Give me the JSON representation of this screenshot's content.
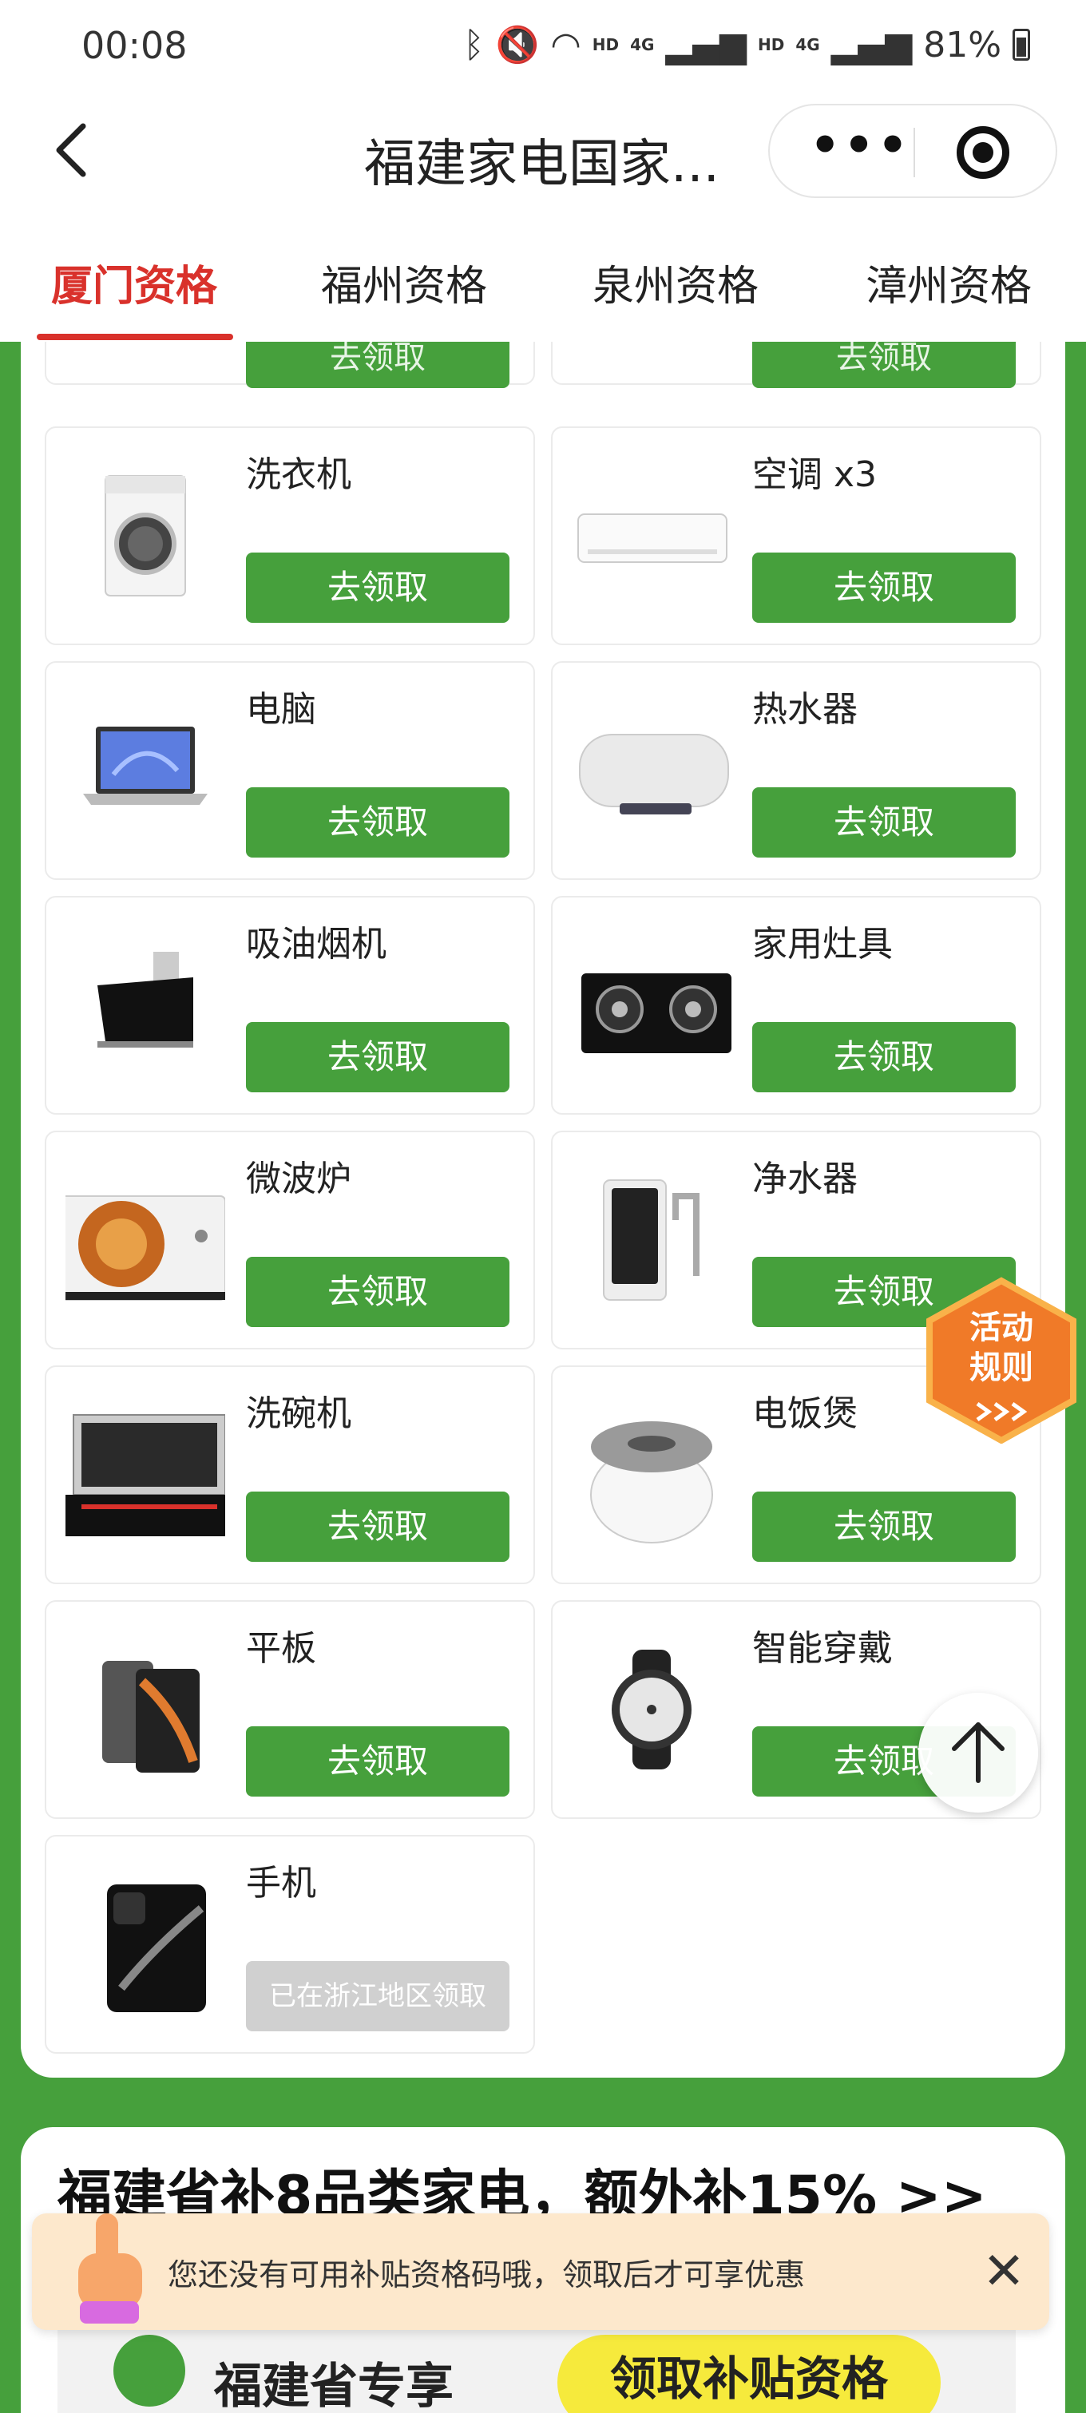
{
  "status_bar": {
    "time": "00:08",
    "hd1": "HD",
    "net1": "4G",
    "hd2": "HD",
    "net2": "4G",
    "battery": "81%"
  },
  "nav": {
    "back_icon": "chevron-left-icon",
    "title": "福建家电国家...",
    "more_icon": "more-dots-icon",
    "close_icon": "target-icon"
  },
  "tabs": [
    {
      "label": "厦门资格",
      "active": true
    },
    {
      "label": "福州资格",
      "active": false
    },
    {
      "label": "泉州资格",
      "active": false
    },
    {
      "label": "漳州资格",
      "active": false
    }
  ],
  "partial_top": {
    "button_label": "去领取"
  },
  "products": [
    {
      "name": "洗衣机",
      "button": "去领取",
      "enabled": true,
      "icon": "washing-machine-icon"
    },
    {
      "name": "空调 x3",
      "button": "去领取",
      "enabled": true,
      "icon": "air-conditioner-icon"
    },
    {
      "name": "电脑",
      "button": "去领取",
      "enabled": true,
      "icon": "laptop-icon"
    },
    {
      "name": "热水器",
      "button": "去领取",
      "enabled": true,
      "icon": "water-heater-icon"
    },
    {
      "name": "吸油烟机",
      "button": "去领取",
      "enabled": true,
      "icon": "range-hood-icon"
    },
    {
      "name": "家用灶具",
      "button": "去领取",
      "enabled": true,
      "icon": "gas-stove-icon"
    },
    {
      "name": "微波炉",
      "button": "去领取",
      "enabled": true,
      "icon": "microwave-icon"
    },
    {
      "name": "净水器",
      "button": "去领取",
      "enabled": true,
      "icon": "water-purifier-icon"
    },
    {
      "name": "洗碗机",
      "button": "去领取",
      "enabled": true,
      "icon": "dishwasher-icon"
    },
    {
      "name": "电饭煲",
      "button": "去领取",
      "enabled": true,
      "icon": "rice-cooker-icon"
    },
    {
      "name": "平板",
      "button": "去领取",
      "enabled": true,
      "icon": "tablet-icon"
    },
    {
      "name": "智能穿戴",
      "button": "去领取",
      "enabled": true,
      "icon": "smartwatch-icon"
    },
    {
      "name": "手机",
      "button": "已在浙江地区领取",
      "enabled": false,
      "icon": "smartphone-icon"
    }
  ],
  "rules_badge": {
    "line1": "活动",
    "line2": "规则"
  },
  "promo": {
    "title": "福建省补8品类家电，额外补15% >>",
    "exclusive_label": "福建省专享",
    "cta_label": "领取补贴资格"
  },
  "toast": {
    "message": "您还没有可用补贴资格码哦，领取后才可享优惠"
  },
  "colors": {
    "accent_green": "#46a03c",
    "active_tab": "#d9312b",
    "toast_bg": "#fde8cc",
    "cta_yellow": "#f6ea3c"
  }
}
